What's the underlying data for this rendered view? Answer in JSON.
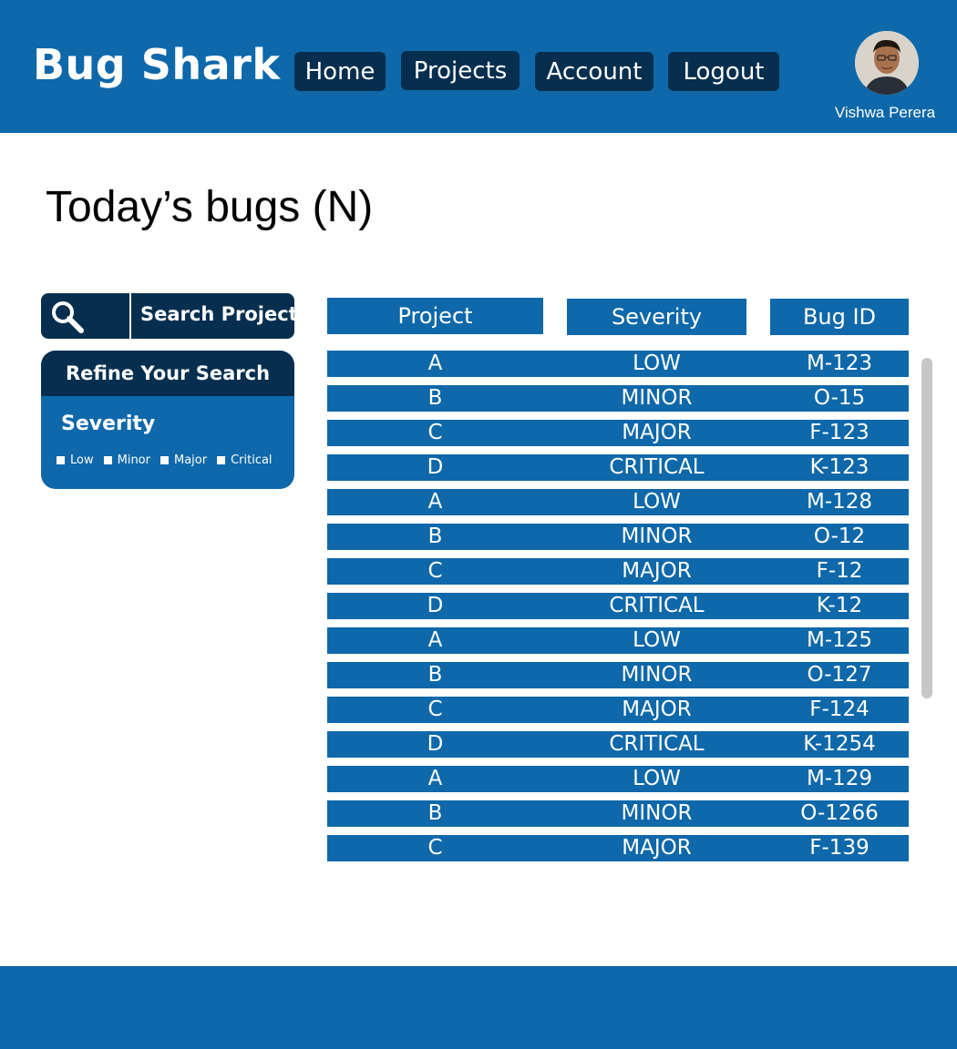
{
  "header": {
    "brand": "Bug Shark",
    "nav": {
      "home": "Home",
      "projects": "Projects",
      "account": "Account",
      "logout": "Logout"
    },
    "user": {
      "name": "Vishwa Perera"
    }
  },
  "page": {
    "title": "Today’s bugs (N)"
  },
  "sidebar": {
    "search_text": "Search Project...",
    "refine_title": "Refine Your Search",
    "severity_label": "Severity",
    "filters": [
      "Low",
      "Minor",
      "Major",
      "Critical"
    ]
  },
  "table": {
    "headers": {
      "project": "Project",
      "severity": "Severity",
      "bug_id": "Bug ID"
    },
    "rows": [
      {
        "project": "A",
        "severity": "LOW",
        "bug_id": "M-123"
      },
      {
        "project": "B",
        "severity": "MINOR",
        "bug_id": "O-15"
      },
      {
        "project": "C",
        "severity": "MAJOR",
        "bug_id": "F-123"
      },
      {
        "project": "D",
        "severity": "CRITICAL",
        "bug_id": "K-123"
      },
      {
        "project": "A",
        "severity": "LOW",
        "bug_id": "M-128"
      },
      {
        "project": "B",
        "severity": "MINOR",
        "bug_id": "O-12"
      },
      {
        "project": "C",
        "severity": "MAJOR",
        "bug_id": "F-12"
      },
      {
        "project": "D",
        "severity": "CRITICAL",
        "bug_id": "K-12"
      },
      {
        "project": "A",
        "severity": "LOW",
        "bug_id": "M-125"
      },
      {
        "project": "B",
        "severity": "MINOR",
        "bug_id": "O-127"
      },
      {
        "project": "C",
        "severity": "MAJOR",
        "bug_id": "F-124"
      },
      {
        "project": "D",
        "severity": "CRITICAL",
        "bug_id": "K-1254"
      },
      {
        "project": "A",
        "severity": "LOW",
        "bug_id": "M-129"
      },
      {
        "project": "B",
        "severity": "MINOR",
        "bug_id": "O-1266"
      },
      {
        "project": "C",
        "severity": "MAJOR",
        "bug_id": "F-139"
      }
    ]
  },
  "icons": {
    "search": "search-icon",
    "avatar": "user-avatar"
  },
  "colors": {
    "primary": "#0e68aa",
    "dark": "#062f4f",
    "scrollbar": "#c7c7c7"
  }
}
